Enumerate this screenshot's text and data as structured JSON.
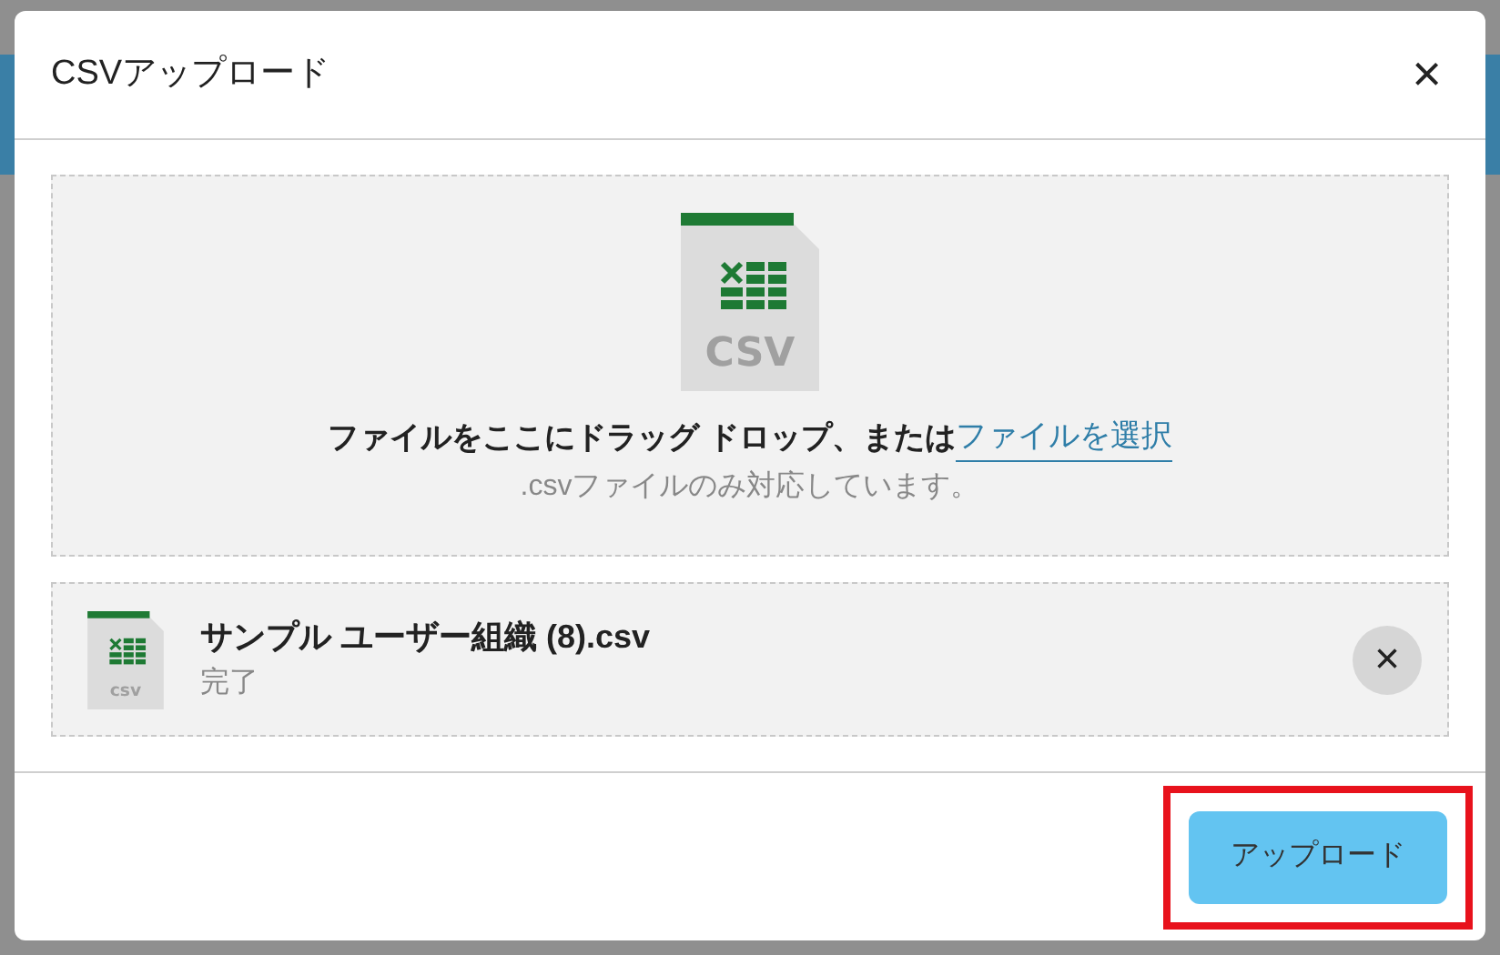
{
  "dialog": {
    "title": "CSVアップロード",
    "close_label": "×"
  },
  "dropzone": {
    "icon_label": "CSV",
    "prompt": "ファイルをここにドラッグ ドロップ、または",
    "link": "ファイルを選択",
    "hint": ".csvファイルのみ対応しています。"
  },
  "files": [
    {
      "icon_label": "csv",
      "name": "サンプル ユーザー組織 (8).csv",
      "status": "完了",
      "remove_label": "×"
    }
  ],
  "upload_button": {
    "label": "アップロード",
    "highlighted": true
  }
}
